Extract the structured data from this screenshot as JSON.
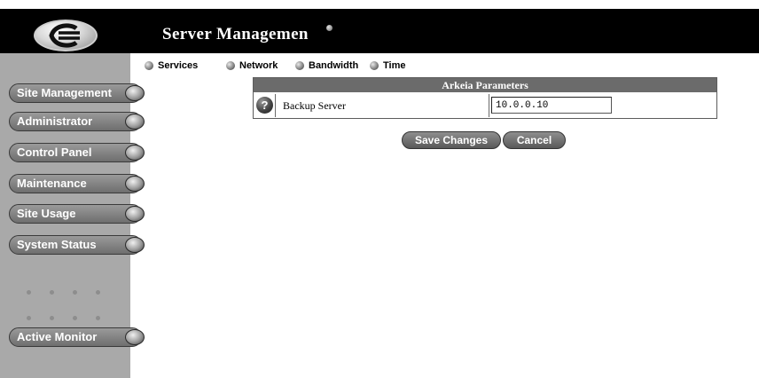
{
  "header": {
    "title": "Server Managemen"
  },
  "sidebar": {
    "items": [
      {
        "label": "Site Management"
      },
      {
        "label": "Administrator"
      },
      {
        "label": "Control Panel"
      },
      {
        "label": "Maintenance"
      },
      {
        "label": "Site Usage"
      },
      {
        "label": "System Status"
      },
      {
        "label": "Active Monitor"
      }
    ]
  },
  "tabs": [
    {
      "label": "Services"
    },
    {
      "label": "Network"
    },
    {
      "label": "Bandwidth"
    },
    {
      "label": "Time"
    }
  ],
  "parameters": {
    "heading": "Arkeia Parameters",
    "rows": [
      {
        "label": "Backup Server",
        "value": "10.0.0.10",
        "help_icon": "?"
      }
    ]
  },
  "actions": {
    "save_label": "Save Changes",
    "cancel_label": "Cancel"
  },
  "colors": {
    "header_bg": "#000000",
    "sidebar_bg": "#a9a9a9",
    "table_header_bg": "#6b6b6b"
  }
}
